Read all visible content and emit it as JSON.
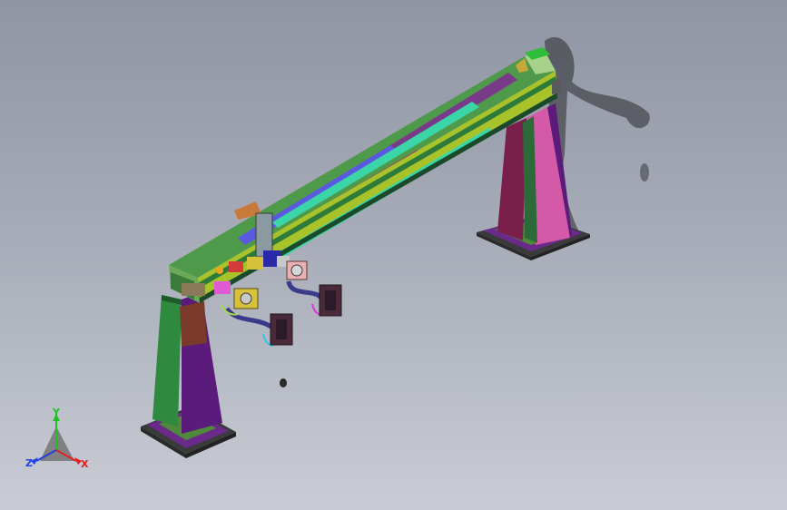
{
  "viewport": {
    "background_top": "#8f95a3",
    "background_bottom": "#c9ccd4"
  },
  "triad": {
    "x_label": "X",
    "y_label": "Y",
    "z_label": "Z",
    "x_color": "#e02020",
    "y_color": "#1fc01f",
    "z_color": "#2040e0"
  },
  "colors": {
    "leg_green": "#2d8a3e",
    "leg_purple": "#5b1b7a",
    "leg_pink": "#d45aa8",
    "leg_maroon": "#7a1f4a",
    "beam_green": "#4f9a4a",
    "beam_yellow": "#a8c22a",
    "beam_blue": "#5a5ae0",
    "beam_cyan": "#3ad6a8",
    "beam_purple": "#7a3a8a",
    "beam_magenta": "#b0206a",
    "base_purple": "#6a2a8a",
    "tag_orange": "#c87a3a"
  }
}
